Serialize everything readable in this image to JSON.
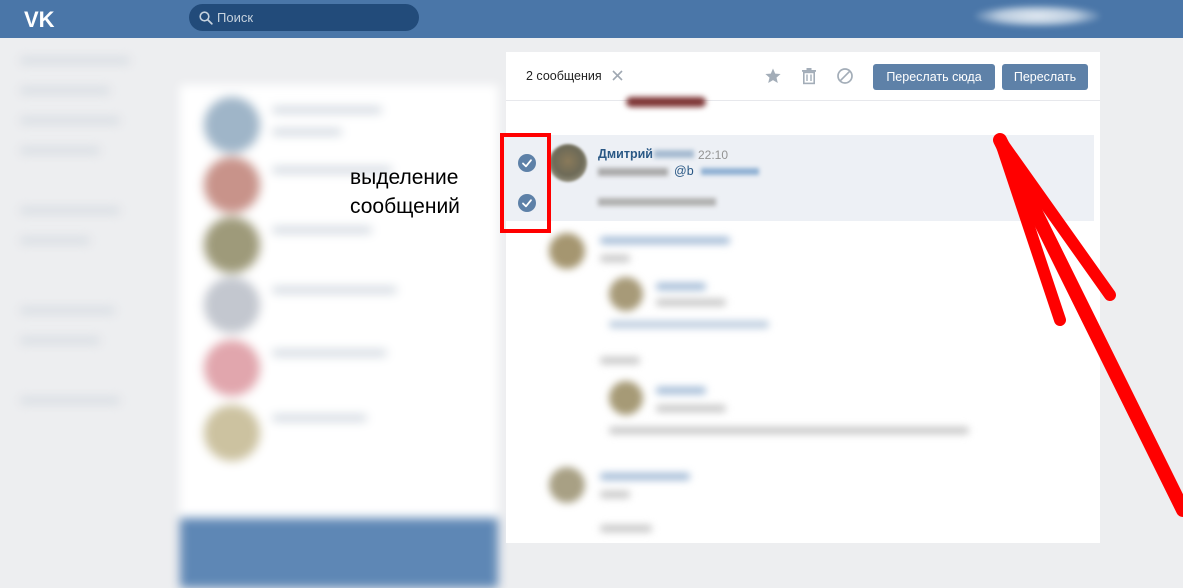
{
  "header": {
    "logo_text": "VK",
    "search_placeholder": "Поиск"
  },
  "chat_header": {
    "selected_count": "2 сообщения",
    "forward_here_label": "Переслать сюда",
    "forward_label": "Переслать"
  },
  "message": {
    "author": "Дмитрий",
    "time": "22:10",
    "mention_prefix": "@b"
  },
  "annotation": {
    "line1": "выделение",
    "line2": "сообщений"
  },
  "colors": {
    "topbar": "#4a76a8",
    "accent": "#5e81a8",
    "annotation": "#ff0000"
  },
  "icons": [
    "vk-logo-icon",
    "search-icon",
    "close-icon",
    "star-icon",
    "trash-icon",
    "block-icon",
    "check-icon"
  ]
}
